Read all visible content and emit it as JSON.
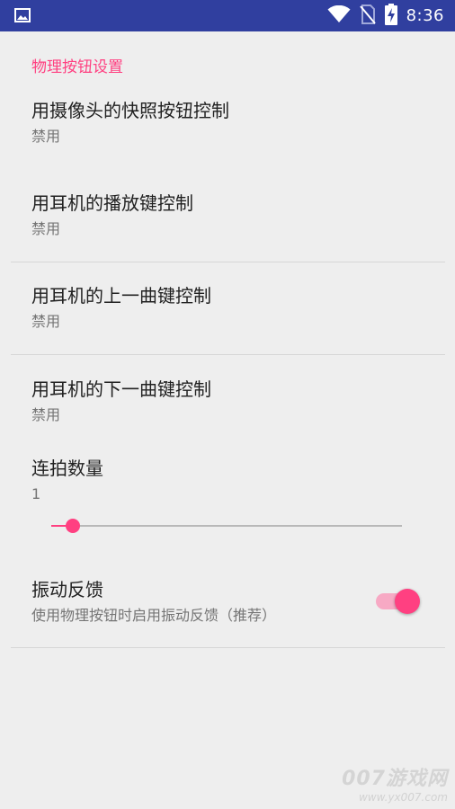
{
  "status_bar": {
    "time": "8:36",
    "icons": [
      "image-notification-icon",
      "wifi-icon",
      "no-sim-icon",
      "battery-charging-icon"
    ],
    "background_color": "#303f9f"
  },
  "section": {
    "title": "物理按钮设置",
    "accent_color": "#ff4081"
  },
  "preferences": [
    {
      "title": "用摄像头的快照按钮控制",
      "summary": "禁用"
    },
    {
      "title": "用耳机的播放键控制",
      "summary": "禁用"
    },
    {
      "title": "用耳机的上一曲键控制",
      "summary": "禁用"
    },
    {
      "title": "用耳机的下一曲键控制",
      "summary": "禁用"
    }
  ],
  "burst": {
    "title": "连拍数量",
    "value": "1",
    "slider_fraction": 0.03
  },
  "vibration": {
    "title": "振动反馈",
    "summary": "使用物理按钮时启用振动反馈（推荐）",
    "enabled": true
  },
  "watermark": {
    "main": "007游戏网",
    "sub": "www.yx007.com"
  }
}
